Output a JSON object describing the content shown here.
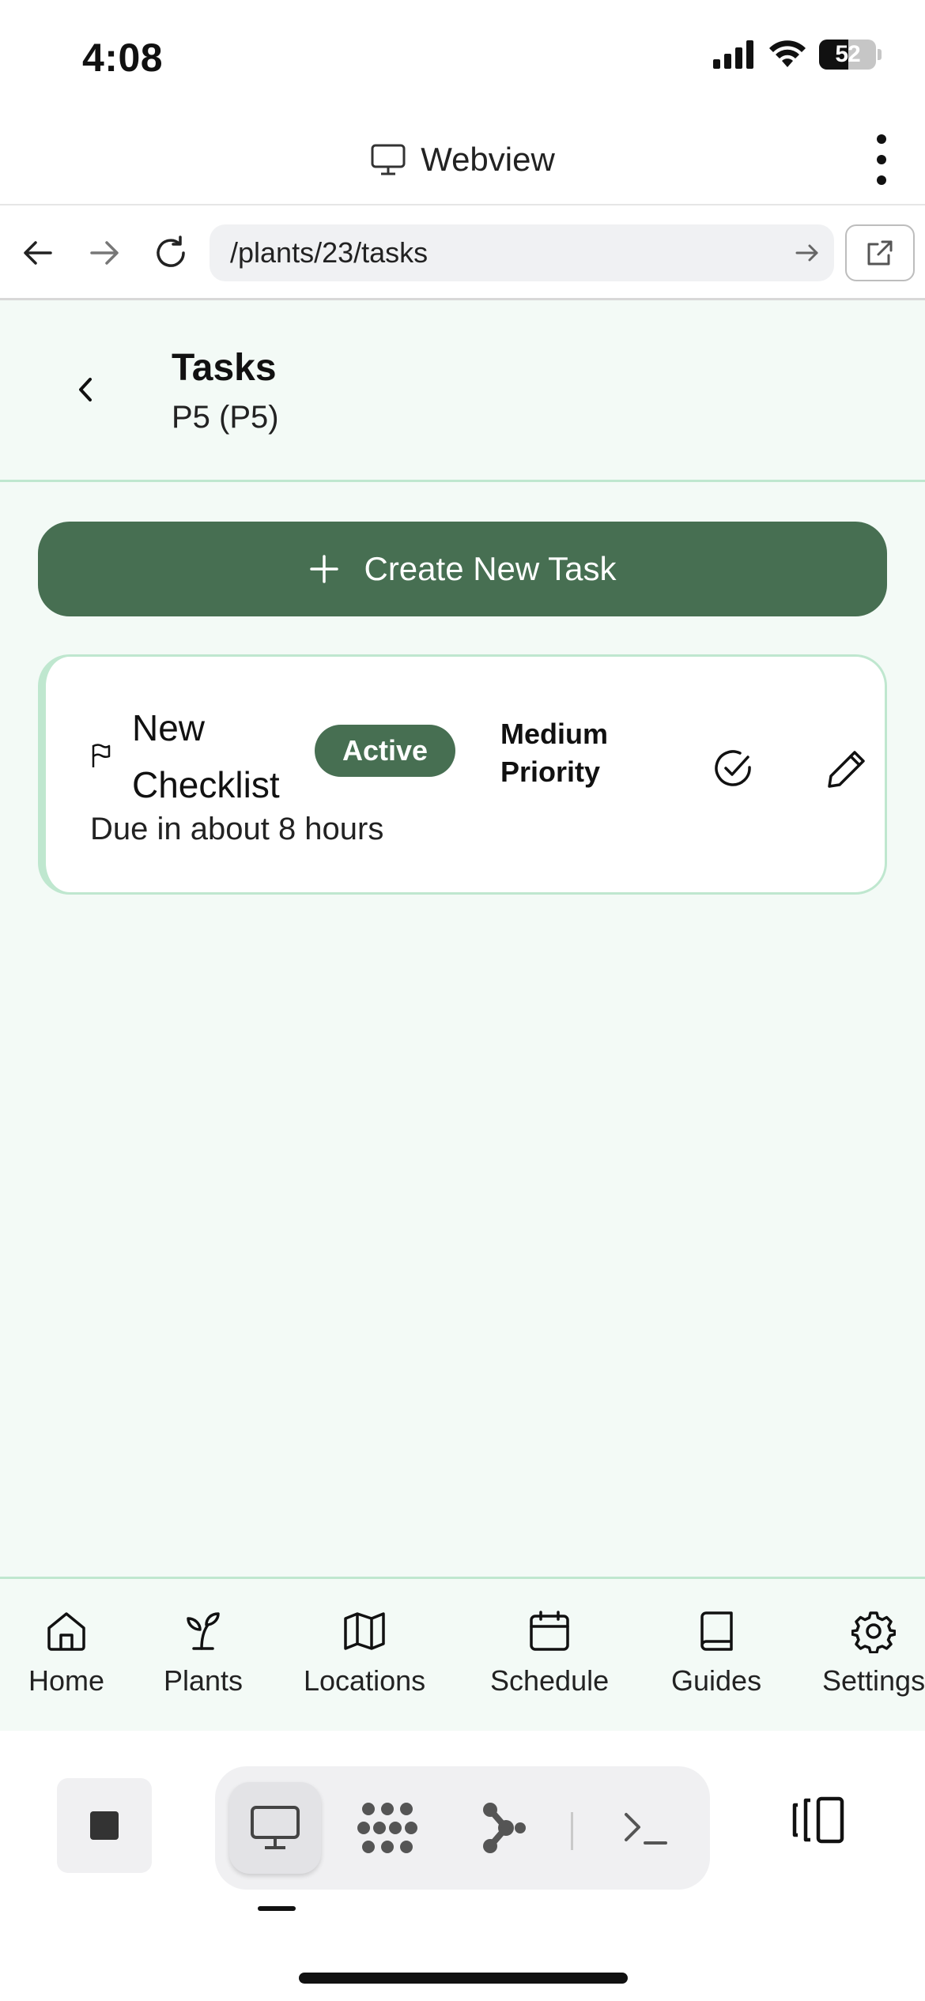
{
  "status_bar": {
    "time": "4:08",
    "battery": "52"
  },
  "webview": {
    "title": "Webview"
  },
  "browser": {
    "url": "/plants/23/tasks"
  },
  "header": {
    "title": "Tasks",
    "subtitle": "P5 (P5)"
  },
  "actions": {
    "create_task_label": "Create New Task"
  },
  "tasks": [
    {
      "title": "New Checklist",
      "status": "Active",
      "priority": "Medium Priority",
      "due": "Due in about 8 hours"
    }
  ],
  "bottom_nav": {
    "items": [
      {
        "label": "Home",
        "icon": "home-icon"
      },
      {
        "label": "Plants",
        "icon": "sprout-icon"
      },
      {
        "label": "Locations",
        "icon": "map-icon"
      },
      {
        "label": "Schedule",
        "icon": "calendar-icon"
      },
      {
        "label": "Guides",
        "icon": "book-icon"
      },
      {
        "label": "Settings",
        "icon": "gear-icon"
      }
    ]
  },
  "toolbar": {
    "items": [
      "stop-icon",
      "monitor-icon",
      "dots-grid-icon",
      "nodes-icon",
      "terminal-icon",
      "panel-icon"
    ]
  },
  "colors": {
    "primary": "#476f52",
    "background": "#f3faf6",
    "border": "#bfe7cf"
  }
}
